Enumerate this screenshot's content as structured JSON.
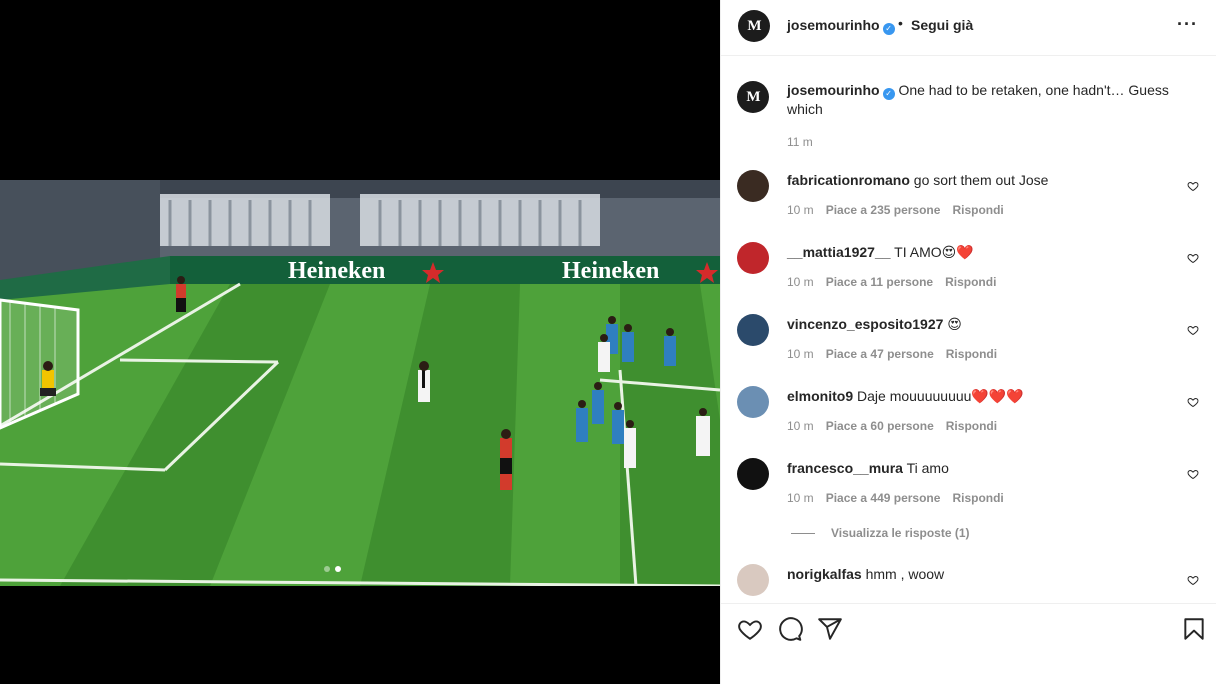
{
  "post": {
    "username": "josemourinho",
    "separator": "•",
    "follow_label": "Segui già",
    "avatar_letters": "M",
    "more_icon": "more-options-icon",
    "caption_text": "One had to be retaken, one hadn't… Guess which",
    "caption_time": "11 m"
  },
  "media": {
    "dots_total": 2,
    "active_dot": 2,
    "banner_text_1": "Heineken",
    "banner_text_2": "Heineken"
  },
  "comments": [
    {
      "user": "fabricationromano",
      "text": "go sort them out Jose",
      "time": "10 m",
      "likes": "Piace a 235 persone",
      "reply": "Rispondi",
      "avatar_color": "#3a2b22"
    },
    {
      "user": "__mattia1927__",
      "text": "TI AMO😍❤️",
      "time": "10 m",
      "likes": "Piace a 11 persone",
      "reply": "Rispondi",
      "avatar_color": "#c0262b"
    },
    {
      "user": "vincenzo_esposito1927",
      "text": "😍",
      "time": "10 m",
      "likes": "Piace a 47 persone",
      "reply": "Rispondi",
      "avatar_color": "#2b4a6b"
    },
    {
      "user": "elmonito9",
      "text": "Daje mouuuuuuuu❤️❤️❤️",
      "time": "10 m",
      "likes": "Piace a 60 persone",
      "reply": "Rispondi",
      "avatar_color": "#6b8fb3"
    },
    {
      "user": "francesco__mura",
      "text": "Ti amo",
      "time": "10 m",
      "likes": "Piace a 449 persone",
      "reply": "Rispondi",
      "avatar_color": "#111111"
    },
    {
      "user": "norigkalfas",
      "text": "hmm , woow",
      "time": "",
      "likes": "",
      "reply": "",
      "avatar_color": "#d9c9c0"
    }
  ],
  "view_replies": "Visualizza le risposte (1)",
  "actions": {
    "like_icon": "heart-icon",
    "comment_icon": "comment-icon",
    "share_icon": "share-icon",
    "save_icon": "bookmark-icon"
  },
  "colors": {
    "pitch_dark": "#3f8f2f",
    "pitch_light": "#4ea23a",
    "blue_kit": "#2f7fc0",
    "verified": "#3897f0",
    "meta_gray": "#8e8e8e"
  }
}
